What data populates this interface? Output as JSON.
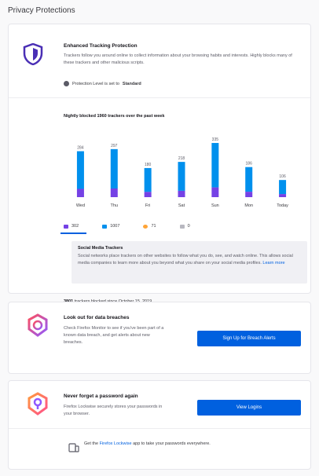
{
  "page": {
    "title": "Privacy Protections"
  },
  "etp": {
    "title": "Enhanced Tracking Protection",
    "description": "Trackers follow you around online to collect information about your browsing habits and interests. Highly blocks many of these trackers and other malicious scripts.",
    "protection_level_prefix": "Protection Level is set to ",
    "protection_level_value": "Standard",
    "chart_title": "Nightly blocked 1960 trackers over the past week",
    "tabs": [
      {
        "label": "302",
        "color": "#7542e5"
      },
      {
        "label": "1007",
        "color": "#0090ed"
      },
      {
        "label": "71",
        "color": "#ffa436"
      },
      {
        "label": "0",
        "color": "#b8b8c0"
      }
    ],
    "panel_title": "Social Media Trackers",
    "panel_text": "Social networks place trackers on other websites to follow what you do, see, and watch online. This allows social media companies to learn more about you beyond what you share on your social media profiles. ",
    "panel_link": "Learn more",
    "total_count": "3801",
    "total_text": " trackers blocked since October 15, 2019"
  },
  "chart_data": {
    "type": "bar",
    "categories": [
      "Wed",
      "Thu",
      "Fri",
      "Sat",
      "Sun",
      "Mon",
      "Today"
    ],
    "values": [
      284,
      297,
      180,
      218,
      335,
      186,
      106
    ],
    "value_labels": [
      "284",
      "297",
      "180",
      "218",
      "335",
      "186",
      "106"
    ],
    "stack_colors": [
      "#7542e5",
      "#0090ed"
    ],
    "ylim": [
      0,
      340
    ]
  },
  "monitor": {
    "title": "Look out for data breaches",
    "description": "Check Firefox Monitor to see if you've been part of a known data breach, and get alerts about new breaches.",
    "button_label": "Sign Up for Breach Alerts"
  },
  "lockwise": {
    "title": "Never forget a password again",
    "description": "Firefox Lockwise securely stores your passwords in your browser.",
    "button_label": "View Logins",
    "app_prefix": "Get the ",
    "app_link": "Firefox Lockwise",
    "app_suffix": " app to take your passwords everywhere."
  }
}
